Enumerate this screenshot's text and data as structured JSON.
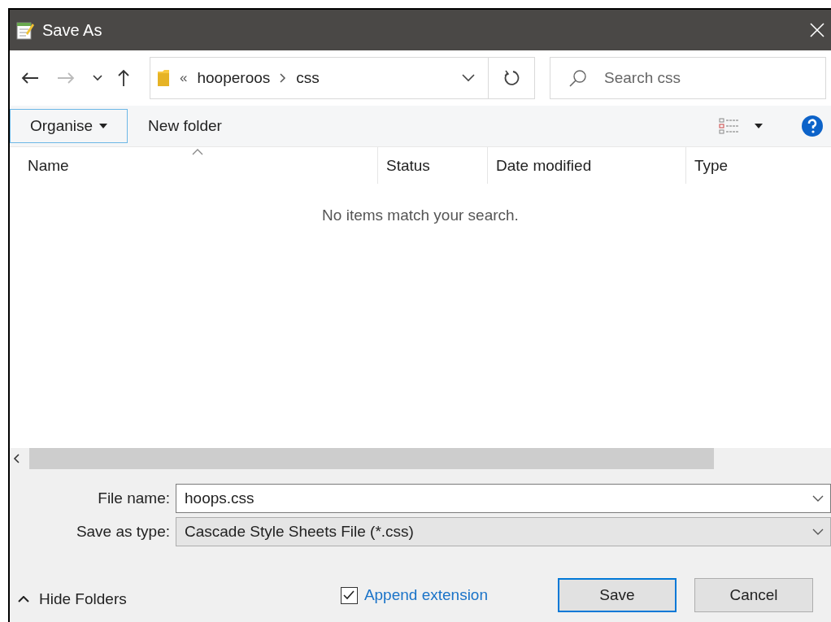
{
  "window": {
    "title": "Save As"
  },
  "navigation": {
    "forward_disabled": true
  },
  "address_bar": {
    "overflow": "«",
    "path": [
      "hooperoos",
      "css"
    ]
  },
  "search": {
    "placeholder": "Search css"
  },
  "toolbar": {
    "buttons": [
      {
        "label": "Organise",
        "kind": "menu",
        "focused": true
      },
      {
        "label": "New folder",
        "kind": "plain",
        "focused": false
      }
    ]
  },
  "file_list": {
    "columns": [
      {
        "label": "Name",
        "sorted": true
      },
      {
        "label": "Status",
        "sorted": false
      },
      {
        "label": "Date modified",
        "sorted": false
      },
      {
        "label": "Type",
        "sorted": false
      }
    ],
    "empty_message": "No items match your search."
  },
  "form": {
    "fields": [
      {
        "label": "File name:",
        "value": "hoops.css",
        "kind": "combo"
      },
      {
        "label": "Save as type:",
        "value": "Cascade Style Sheets File (*.css)",
        "kind": "dropdown"
      }
    ]
  },
  "footer": {
    "hide_folders": "Hide Folders",
    "append_extension": {
      "label": "Append extension",
      "checked": true
    },
    "buttons": [
      {
        "label": "Save",
        "default": true
      },
      {
        "label": "Cancel",
        "default": false
      }
    ]
  }
}
